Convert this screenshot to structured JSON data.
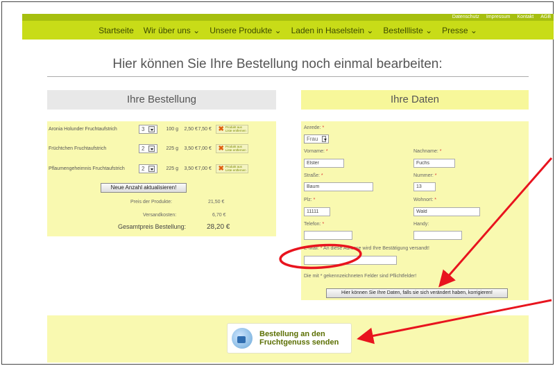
{
  "toplinks": [
    "Datenschutz",
    "Impressum",
    "Kontakt",
    "AGB"
  ],
  "nav": [
    "Startseite",
    "Wir über uns ⌄",
    "Unsere Produkte ⌄",
    "Laden in Haselstein ⌄",
    "Bestellliste ⌄",
    "Presse ⌄"
  ],
  "heading": "Hier können Sie Ihre Bestellung noch einmal bearbeiten:",
  "order": {
    "title": "Ihre Bestellung",
    "items": [
      {
        "name": "Aronia Holunder Fruchtaufstrich",
        "qty": "3",
        "weight": "100 g",
        "price": "2,50 €",
        "total": "7,50 €"
      },
      {
        "name": "Früchtchen Fruchtaufstrich",
        "qty": "2",
        "weight": "225 g",
        "price": "3,50 €",
        "total": "7,00 €"
      },
      {
        "name": "Pflaumengeheimnis Fruchtaufstrich",
        "qty": "2",
        "weight": "225 g",
        "price": "3,50 €",
        "total": "7,00 €"
      }
    ],
    "remove_label": "Produkt aus Liste entfernen",
    "update_button": "Neue Anzahl aktualisieren!",
    "products_price_label": "Preis der Produkte:",
    "products_price": "21,50 €",
    "shipping_label": "Versandkosten:",
    "shipping": "6,70 €",
    "total_label": "Gesamtpreis Bestellung:",
    "total": "28,20 €"
  },
  "data": {
    "title": "Ihre Daten",
    "salutation_label": "Anrede:",
    "salutation_value": "Frau",
    "firstname_label": "Vorname:",
    "firstname_value": "Elster",
    "lastname_label": "Nachname:",
    "lastname_value": "Fuchs",
    "street_label": "Straße:",
    "street_value": "Baum",
    "number_label": "Nummer:",
    "number_value": "13",
    "zip_label": "Plz:",
    "zip_value": "11111",
    "city_label": "Wohnort:",
    "city_value": "Wald",
    "phone_label": "Telefon:",
    "mobile_label": "Handy:",
    "email_label": "E-Mail:",
    "email_note": "An diese Adresse wird Ihre Bestätigung versandt!",
    "required_note": "Die mit * gekennzeichneten Felder sind Pflichtfelder!",
    "correct_button": "Hier können Sie Ihre Daten, falls sie sich verändert haben, korrigieren!"
  },
  "send_button": "Bestellung an den Fruchtgenuss senden",
  "colors": {
    "nav_bg": "#c8dc18",
    "topbar_bg": "#a6bf0f",
    "panel_bg": "#f9f9b0",
    "annotation": "#e8141e"
  }
}
